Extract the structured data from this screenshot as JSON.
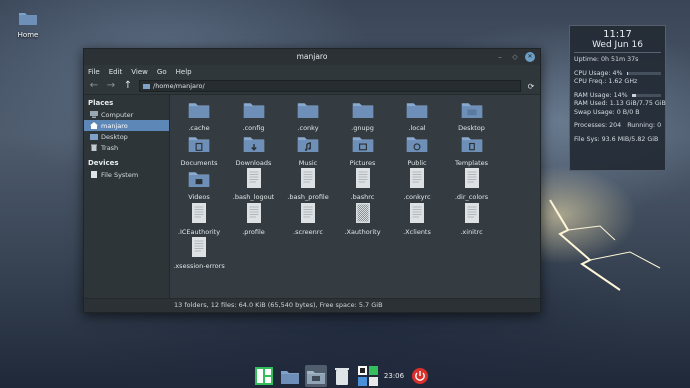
{
  "desktop": {
    "home_icon_label": "Home"
  },
  "window": {
    "title": "manjaro",
    "menu": [
      "File",
      "Edit",
      "View",
      "Go",
      "Help"
    ],
    "path": "/home/manjaro/",
    "sidebar": {
      "places_header": "Places",
      "places": [
        {
          "label": "Computer",
          "icon": "computer-icon"
        },
        {
          "label": "manjaro",
          "icon": "home-icon",
          "active": true
        },
        {
          "label": "Desktop",
          "icon": "desktop-icon"
        },
        {
          "label": "Trash",
          "icon": "trash-icon"
        }
      ],
      "devices_header": "Devices",
      "devices": [
        {
          "label": "File System",
          "icon": "drive-icon"
        }
      ]
    },
    "files": [
      {
        "name": ".cache",
        "type": "folder"
      },
      {
        "name": ".config",
        "type": "folder"
      },
      {
        "name": ".conky",
        "type": "folder"
      },
      {
        "name": ".gnupg",
        "type": "folder"
      },
      {
        "name": ".local",
        "type": "folder"
      },
      {
        "name": "Desktop",
        "type": "folder-desktop"
      },
      {
        "name": "Documents",
        "type": "folder-documents"
      },
      {
        "name": "Downloads",
        "type": "folder-downloads"
      },
      {
        "name": "Music",
        "type": "folder-music"
      },
      {
        "name": "Pictures",
        "type": "folder-pictures"
      },
      {
        "name": "Public",
        "type": "folder-public"
      },
      {
        "name": "Templates",
        "type": "folder-templates"
      },
      {
        "name": "Videos",
        "type": "folder-videos"
      },
      {
        "name": ".bash_logout",
        "type": "file"
      },
      {
        "name": ".bash_profile",
        "type": "file"
      },
      {
        "name": ".bashrc",
        "type": "file"
      },
      {
        "name": ".conkyrc",
        "type": "file"
      },
      {
        "name": ".dir_colors",
        "type": "file"
      },
      {
        "name": ".ICEauthority",
        "type": "file"
      },
      {
        "name": ".profile",
        "type": "file"
      },
      {
        "name": ".screenrc",
        "type": "file"
      },
      {
        "name": ".Xauthority",
        "type": "file-binary"
      },
      {
        "name": ".Xclients",
        "type": "file"
      },
      {
        "name": ".xinitrc",
        "type": "file"
      },
      {
        "name": ".xsession-errors",
        "type": "file"
      }
    ],
    "status": "13 folders, 12 files: 64.0 KiB (65,540 bytes), Free space: 5.7 GiB"
  },
  "conky": {
    "time": "11:17",
    "date": "Wed Jun 16",
    "uptime": "Uptime: 0h 51m 37s",
    "cpu_usage": "CPU Usage: 4%",
    "cpu_usage_fraction": 0.04,
    "cpu_freq": "CPU Freq.: 1.62 GHz",
    "ram_usage": "RAM Usage: 14%",
    "ram_usage_fraction": 0.14,
    "ram_used": "RAM Used: 1.13 GiB/7.75 GiB",
    "swap_usage": "Swap Usage: 0 B/0 B",
    "processes": "Processes: 204",
    "running": "Running: 0",
    "filesys": "File Sys: 93.6 MiB/5.82 GiB",
    "filesys_fraction": 0.016
  },
  "dock": {
    "items": [
      "manjaro-logo-icon",
      "folder-icon",
      "file-manager-icon",
      "trash-icon",
      "multitask-icon"
    ],
    "clock": "23:06",
    "power_icon": "power-icon"
  },
  "colors": {
    "accent": "#5d87b6",
    "folder": "#6d8fb8",
    "power": "#d9302c",
    "manjaro_green": "#35bf5c"
  }
}
